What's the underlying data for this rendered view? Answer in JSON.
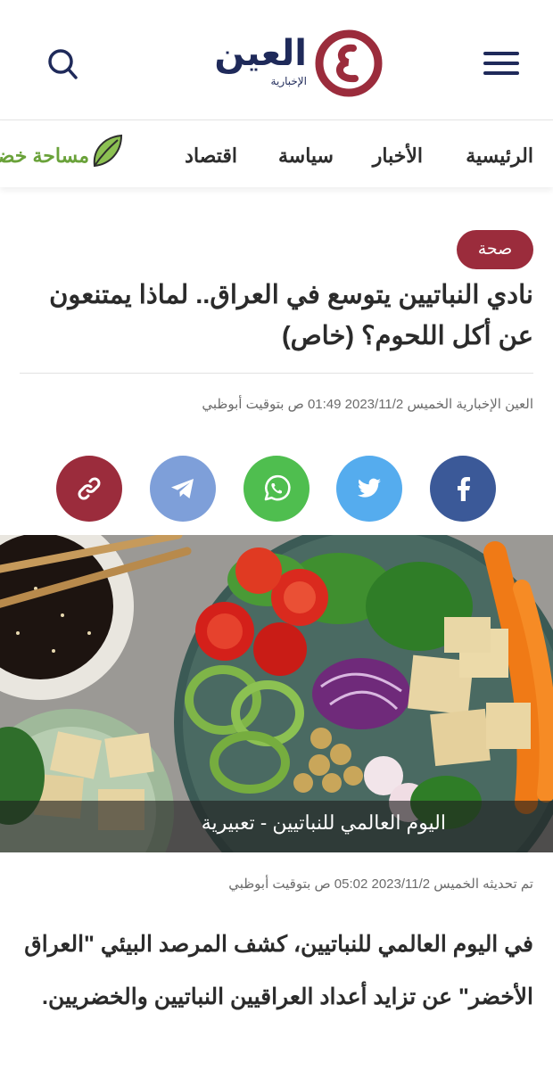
{
  "header": {
    "logo_name": "العين",
    "logo_sub": "الإخبارية",
    "logo_mark_letter": "ع",
    "menu_icon": "hamburger-menu-icon",
    "search_icon": "search-icon"
  },
  "nav": {
    "items": [
      {
        "label": "الرئيسية"
      },
      {
        "label": "الأخبار"
      },
      {
        "label": "سياسة"
      },
      {
        "label": "اقتصاد"
      },
      {
        "label": "مساحة خضراء"
      }
    ]
  },
  "article": {
    "category": "صحة",
    "title": "نادي النباتيين يتوسع في العراق.. لماذا يمتنعون عن أكل اللحوم؟ (خاص)",
    "meta": "العين الإخبارية الخميس 2023/11/2 01:49 ص بتوقيت أبوظبي",
    "image_caption": "اليوم العالمي للنباتيين - تعبيرية",
    "updated": "تم تحديثه الخميس 2023/11/2 05:02 ص بتوقيت أبوظبي",
    "body_lead": "في اليوم العالمي للنباتيين، كشف المرصد البيئي \"العراق الأخضر\" عن تزايد أعداد العراقيين النباتيين والخضريين."
  },
  "share": [
    {
      "name": "facebook",
      "icon": "facebook-icon",
      "color": "#3b5998"
    },
    {
      "name": "twitter",
      "icon": "twitter-icon",
      "color": "#55acee"
    },
    {
      "name": "whatsapp",
      "icon": "whatsapp-icon",
      "color": "#4fbe4f"
    },
    {
      "name": "telegram",
      "icon": "telegram-icon",
      "color": "#7e9fd9"
    },
    {
      "name": "copy-link",
      "icon": "link-icon",
      "color": "#9b2c3c"
    }
  ],
  "colors": {
    "brand_navy": "#1f2a5a",
    "brand_red": "#9b2c3c",
    "green": "#6aa23a"
  }
}
